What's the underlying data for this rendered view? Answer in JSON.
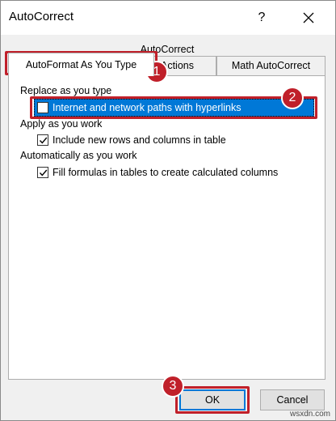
{
  "window": {
    "title": "AutoCorrect",
    "help_label": "?"
  },
  "tabs": {
    "autocorrect": "AutoCorrect",
    "autoformat": "AutoFormat As You Type",
    "actions": "Actions",
    "math": "Math AutoCorrect"
  },
  "groups": {
    "replace": {
      "label": "Replace as you type",
      "items": [
        {
          "label": "Internet and network paths with hyperlinks",
          "checked": false,
          "selected": true
        }
      ]
    },
    "apply": {
      "label": "Apply as you work",
      "items": [
        {
          "label": "Include new rows and columns in table",
          "checked": true
        }
      ]
    },
    "auto": {
      "label": "Automatically as you work",
      "items": [
        {
          "label": "Fill formulas in tables to create calculated columns",
          "checked": true
        }
      ]
    }
  },
  "buttons": {
    "ok": "OK",
    "cancel": "Cancel"
  },
  "callouts": [
    "1",
    "2",
    "3"
  ],
  "watermark": "wsxdn.com",
  "colors": {
    "accent": "#0078d7",
    "callout": "#c0202a"
  }
}
